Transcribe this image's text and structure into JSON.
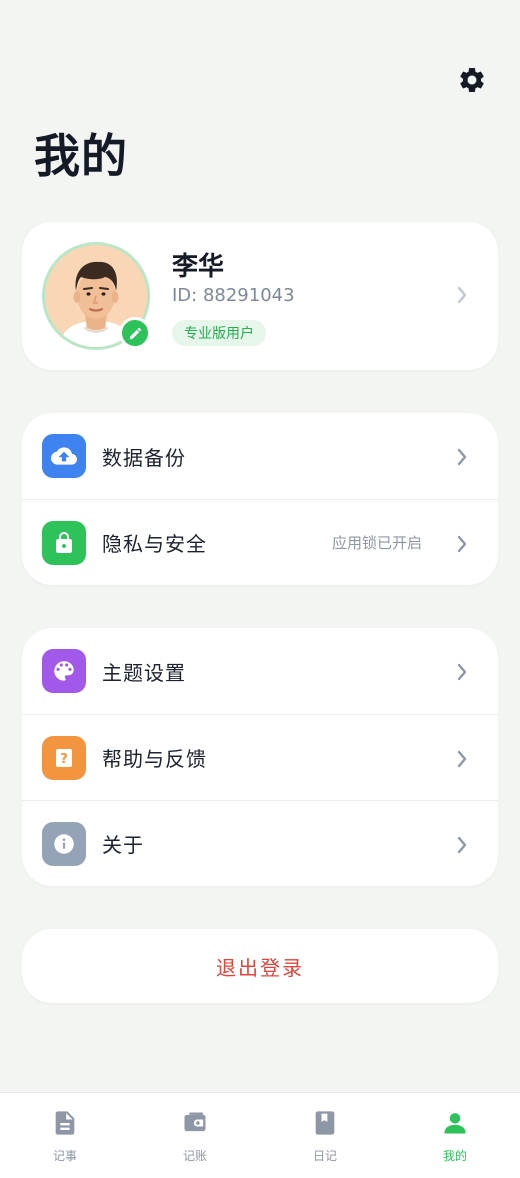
{
  "header": {
    "title": "我的",
    "settings_icon": "gear-icon"
  },
  "profile": {
    "name": "李华",
    "id_text": "ID: 88291043",
    "badge": "专业版用户",
    "avatar_ring_color": "#b8e6c6",
    "edit_icon": "pencil-icon"
  },
  "menu_group_1": [
    {
      "label": "数据备份",
      "icon": "cloud-upload-icon",
      "icon_color": "#3f83f0",
      "status": ""
    },
    {
      "label": "隐私与安全",
      "icon": "lock-icon",
      "icon_color": "#2ec25a",
      "status": "应用锁已开启"
    }
  ],
  "menu_group_2": [
    {
      "label": "主题设置",
      "icon": "palette-icon",
      "icon_color": "#a258e8"
    },
    {
      "label": "帮助与反馈",
      "icon": "help-icon",
      "icon_color": "#f3953f"
    },
    {
      "label": "关于",
      "icon": "info-icon",
      "icon_color": "#95a3b8"
    }
  ],
  "logout": {
    "label": "退出登录",
    "color": "#e0443a"
  },
  "tabbar": {
    "active_color": "#2ec25a",
    "tabs": [
      {
        "label": "记事",
        "icon": "note-document-icon",
        "active": false
      },
      {
        "label": "记账",
        "icon": "wallet-icon",
        "active": false
      },
      {
        "label": "日记",
        "icon": "diary-book-icon",
        "active": false
      },
      {
        "label": "我的",
        "icon": "person-icon",
        "active": true
      }
    ]
  }
}
